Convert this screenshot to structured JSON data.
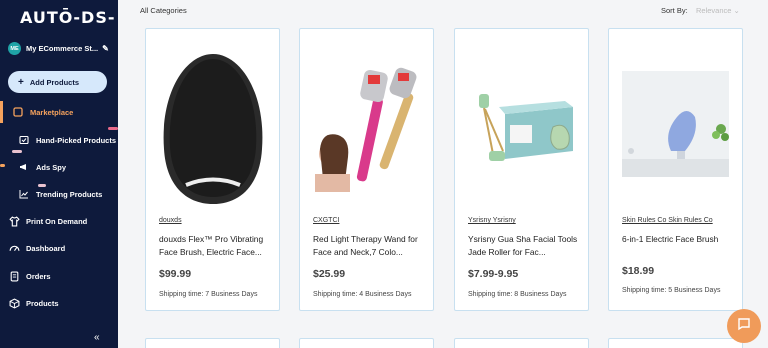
{
  "sidebar": {
    "logo": "AUTŌ-DS-",
    "avatar_initials": "ME",
    "store_name": "My ECommerce St...",
    "add_products_label": "Add Products",
    "items": [
      {
        "label": "Marketplace",
        "icon": "marketplace-icon"
      },
      {
        "label": "Hand-Picked Products",
        "icon": "hand-picked-icon"
      },
      {
        "label": "Ads Spy",
        "icon": "ads-spy-icon"
      },
      {
        "label": "Trending Products",
        "icon": "trending-icon"
      },
      {
        "label": "Print On Demand",
        "icon": "shirt-icon"
      },
      {
        "label": "Dashboard",
        "icon": "dashboard-icon"
      },
      {
        "label": "Orders",
        "icon": "orders-icon"
      },
      {
        "label": "Products",
        "icon": "products-icon"
      }
    ],
    "collapse_icon": "«"
  },
  "header": {
    "category_label": "All Categories",
    "sort_label": "Sort By:",
    "sort_value": "Relevance"
  },
  "products": [
    {
      "brand": "douxds",
      "title": "douxds Flex™ Pro Vibrating Face Brush, Electric Face...",
      "price": "$99.99",
      "shipping": "Shipping time: 7 Business Days"
    },
    {
      "brand": "CXGTCI",
      "title": "Red Light Therapy Wand for Face and Neck,7 Colo...",
      "price": "$25.99",
      "shipping": "Shipping time: 4 Business Days"
    },
    {
      "brand": "Ysrisny Ysrisny",
      "title": "Ysrisny Gua Sha Facial Tools Jade Roller for Fac...",
      "price": "$7.99-9.95",
      "shipping": "Shipping time: 8 Business Days"
    },
    {
      "brand": "Skin Rules Co Skin Rules Co",
      "title": "6-in-1 Electric Face Brush",
      "price": "$18.99",
      "shipping": "Shipping time: 5 Business Days"
    }
  ],
  "colors": {
    "sidebar_bg": "#0e1a3c",
    "accent": "#f5a25d",
    "card_border": "#c8e0f0",
    "chat_button": "#f09b5a"
  }
}
